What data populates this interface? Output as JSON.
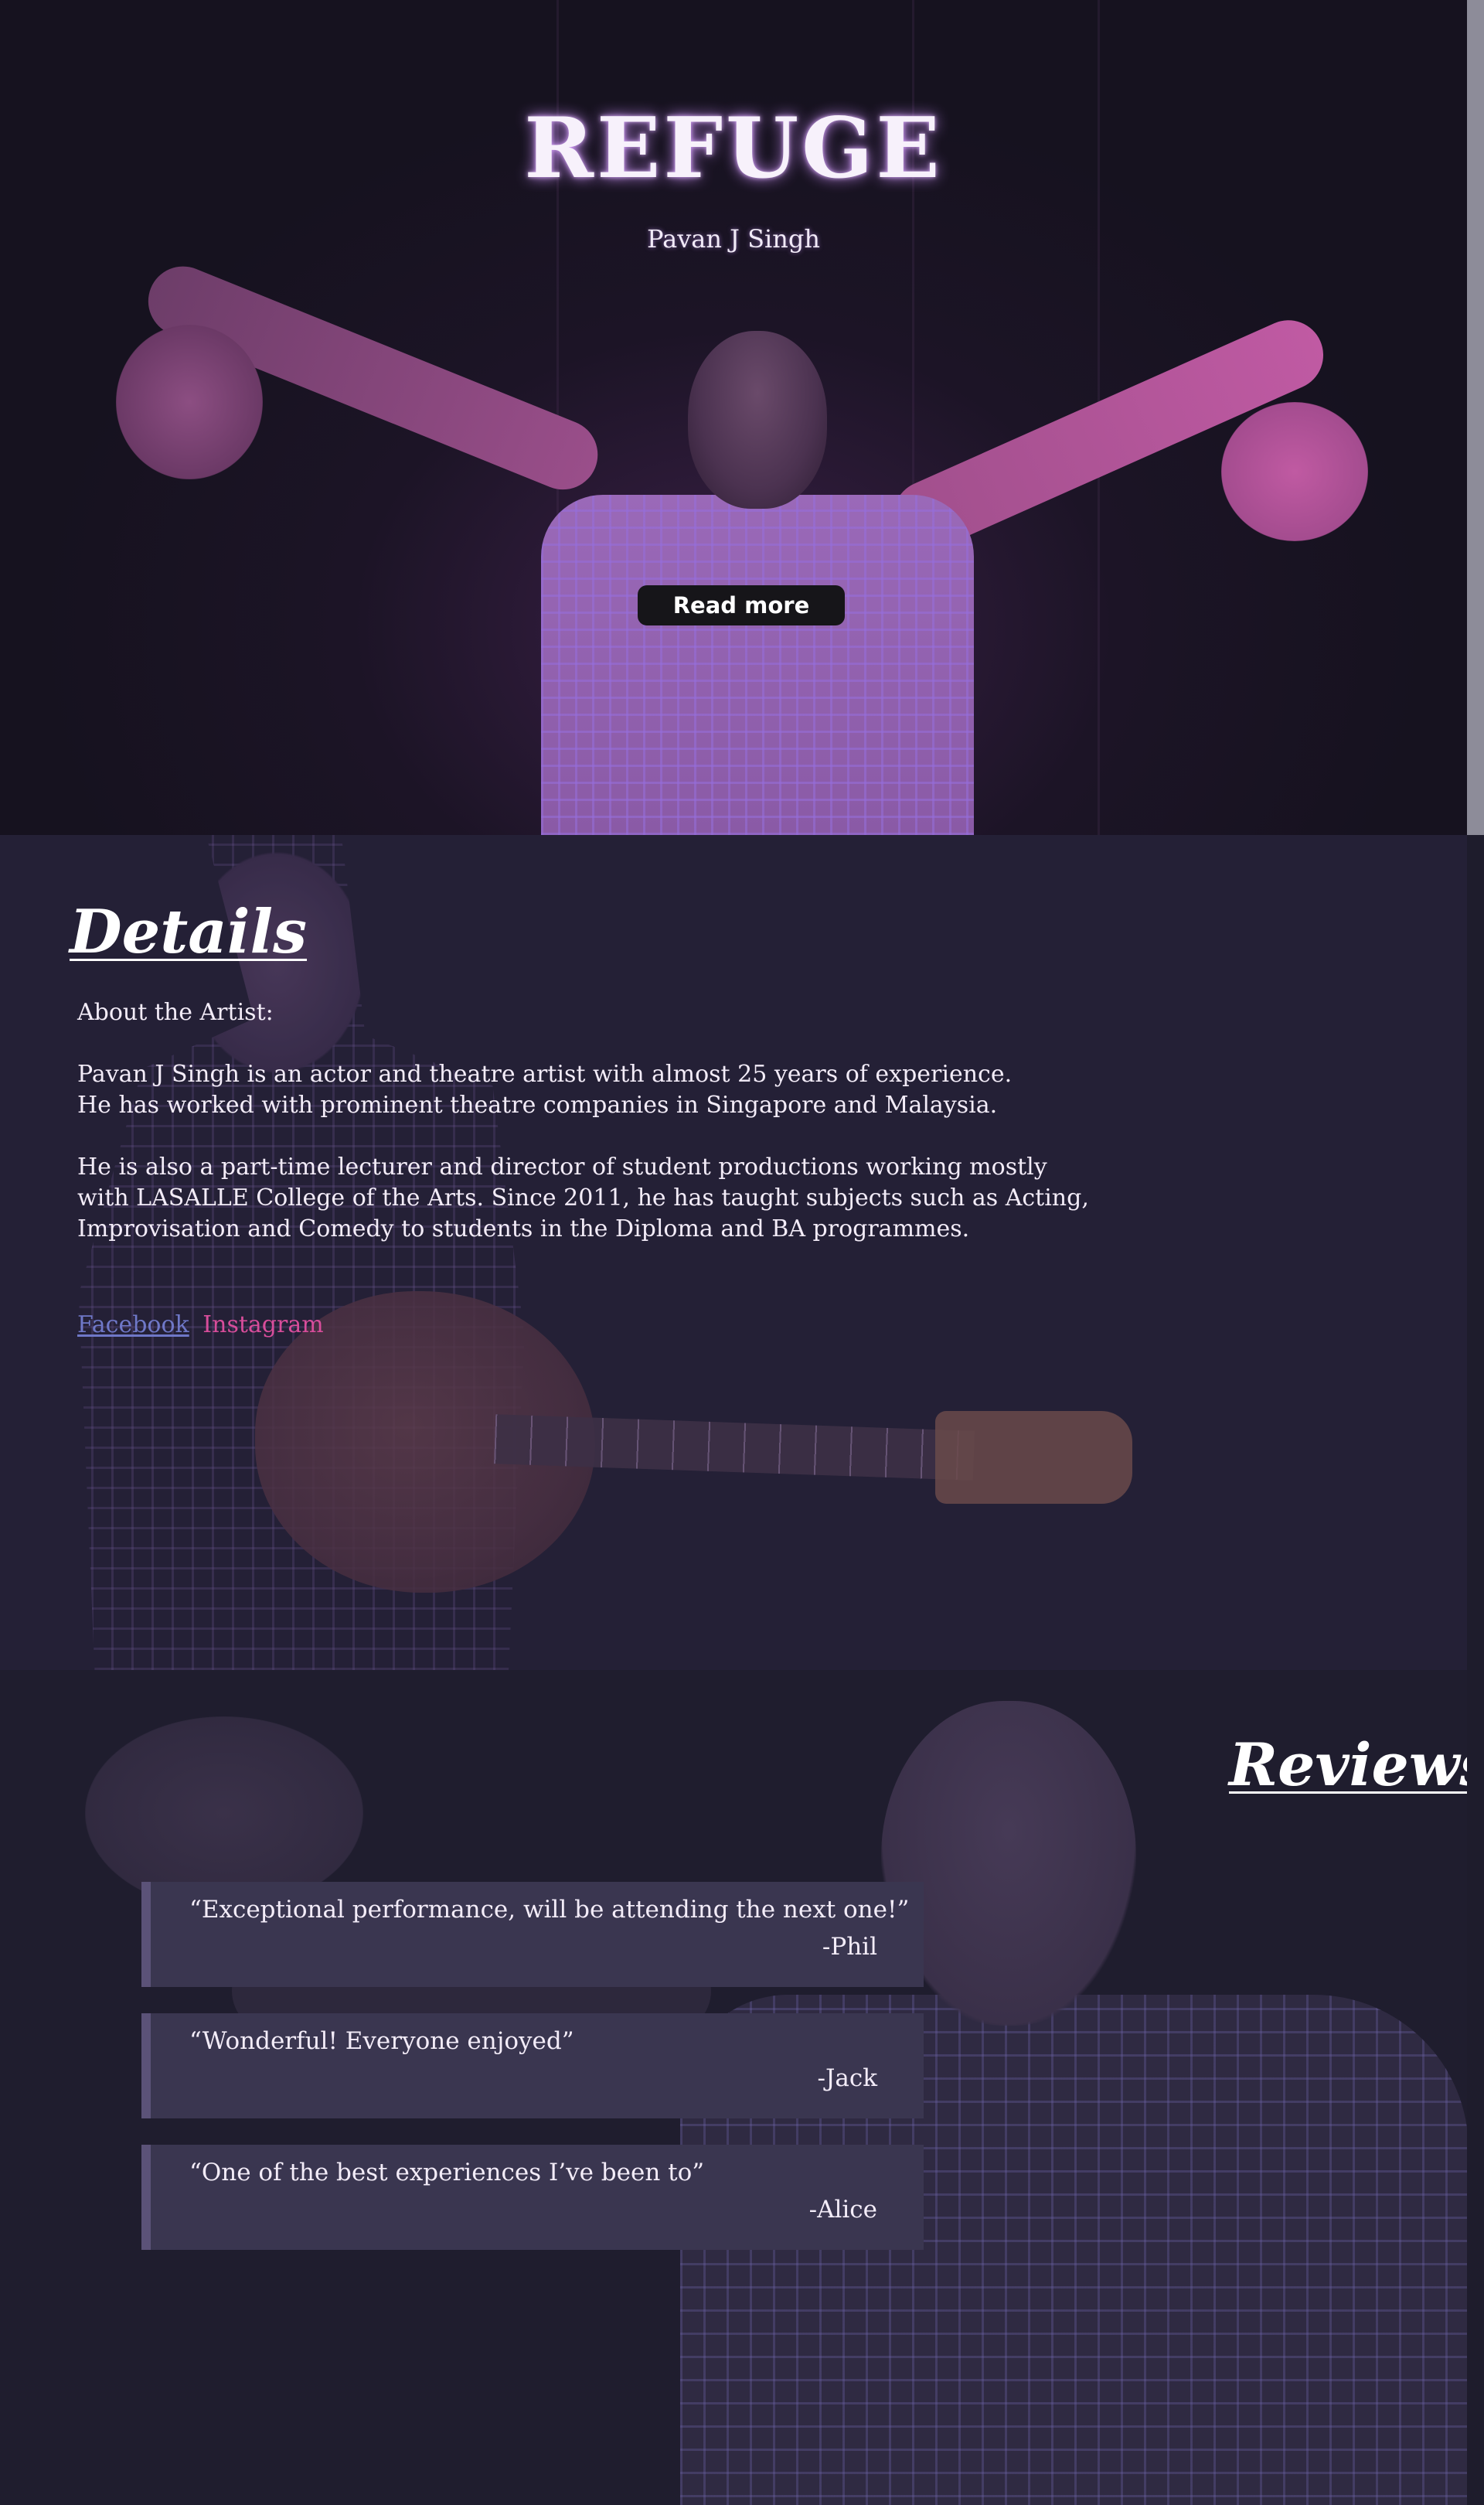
{
  "hero": {
    "title": "REFUGE",
    "subtitle": "Pavan J Singh",
    "read_more_label": "Read more"
  },
  "details": {
    "heading": "Details",
    "about_label": "About the Artist:",
    "paragraph_1_line_1": "Pavan J Singh is an actor and theatre artist with almost 25 years of experience.",
    "paragraph_1_line_2": "He has worked with prominent theatre companies in Singapore and Malaysia.",
    "paragraph_2_line_1": "He is also a part-time lecturer and director of student productions working mostly",
    "paragraph_2_line_2": "with LASALLE College of the Arts. Since 2011, he has taught subjects such as Acting,",
    "paragraph_2_line_3": "Improvisation and Comedy to students in the Diploma and BA programmes.",
    "social": {
      "facebook_label": "Facebook",
      "instagram_label": "Instagram"
    }
  },
  "reviews": {
    "heading": "Reviews",
    "items": [
      {
        "quote": "“Exceptional performance, will be attending the next one!”",
        "author": "-Phil"
      },
      {
        "quote": "“Wonderful! Everyone enjoyed”",
        "author": "-Jack"
      },
      {
        "quote": "“One of the best experiences I’ve been to”",
        "author": "-Alice"
      }
    ]
  },
  "colors": {
    "page_background": "#1e1c2c",
    "review_card": "#3a3650",
    "facebook_link": "#6f78c8",
    "instagram_link": "#d84d9b"
  }
}
